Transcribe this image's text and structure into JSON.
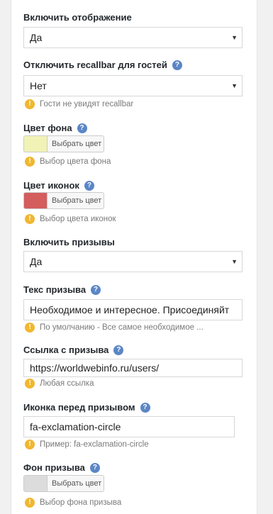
{
  "fields": {
    "display": {
      "label": "Включить отображение",
      "value": "Да"
    },
    "guests": {
      "label": "Отключить recallbar для гостей",
      "value": "Нет",
      "note": "Гости не увидят recallbar"
    },
    "bg_color": {
      "label": "Цвет фона",
      "button": "Выбрать цвет",
      "note": "Выбор цвета фона",
      "color": "#f1f2b5"
    },
    "icon_color": {
      "label": "Цвет иконок",
      "button": "Выбрать цвет",
      "note": "Выбор цвета иконок",
      "color": "#d45d5d"
    },
    "calls": {
      "label": "Включить призывы",
      "value": "Да"
    },
    "call_text": {
      "label": "Текс призыва",
      "value": "Необходимое и интересное. Присоединяйт",
      "note": "По умолчанию - Все самое необходимое ..."
    },
    "call_link": {
      "label": "Ссылка с призыва",
      "value": "https://worldwebinfo.ru/users/",
      "note": "Любая ссылка"
    },
    "call_icon": {
      "label": "Иконка перед призывом",
      "value": "fa-exclamation-circle",
      "note": "Пример: fa-exclamation-circle"
    },
    "call_bg": {
      "label": "Фон призыва",
      "button": "Выбрать цвет",
      "note": "Выбор фона призыва",
      "color": "#dcdcdc"
    }
  },
  "icons": {
    "help": "?",
    "warning": "!",
    "caret": "▼"
  }
}
